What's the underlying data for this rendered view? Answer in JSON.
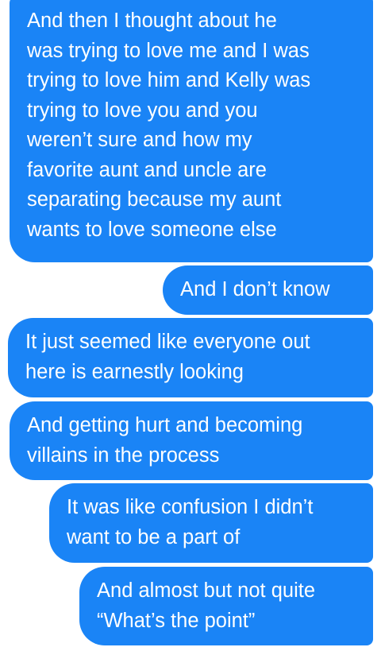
{
  "theme": {
    "bubble_color": "#1a84f6",
    "text_color": "#ffffff",
    "background": "#ffffff"
  },
  "messages": [
    {
      "lines": [
        "And then I thought about he",
        "was trying to love me and I was",
        "trying to love him and Kelly was",
        "trying to love you and you",
        "weren’t sure and how my",
        "favorite aunt and uncle are",
        "separating because my aunt",
        "wants to love someone else"
      ]
    },
    {
      "lines": [
        "And I don’t know"
      ]
    },
    {
      "lines": [
        "It just seemed like everyone out",
        "here is earnestly looking"
      ]
    },
    {
      "lines": [
        "And getting hurt and becoming",
        "villains in the process"
      ]
    },
    {
      "lines": [
        "It was like confusion I didn’t",
        "want to be a part of"
      ]
    },
    {
      "lines": [
        "And almost but not quite",
        "“What’s the point”"
      ]
    }
  ]
}
